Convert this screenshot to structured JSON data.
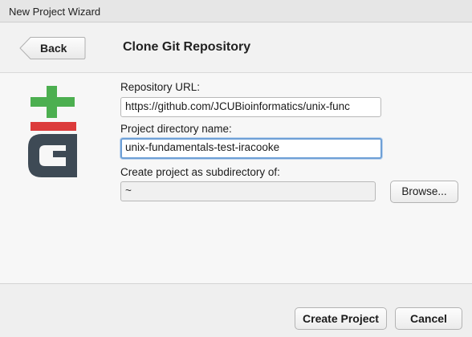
{
  "window": {
    "title": "New Project Wizard"
  },
  "header": {
    "back_label": "Back",
    "page_title": "Clone Git Repository"
  },
  "logo": {
    "icon": "git-logo-icon",
    "plus_color": "#4caf50",
    "bar_color": "#dc3b3b",
    "body_color": "#3e4a55"
  },
  "form": {
    "repo_url_label": "Repository URL:",
    "repo_url_value": "https://github.com/JCUBioinformatics/unix-func",
    "dir_name_label": "Project directory name:",
    "dir_name_value": "unix-fundamentals-test-iracooke",
    "subdir_label": "Create project as subdirectory of:",
    "subdir_value": "~",
    "browse_label": "Browse..."
  },
  "footer": {
    "create_label": "Create Project",
    "cancel_label": "Cancel"
  }
}
